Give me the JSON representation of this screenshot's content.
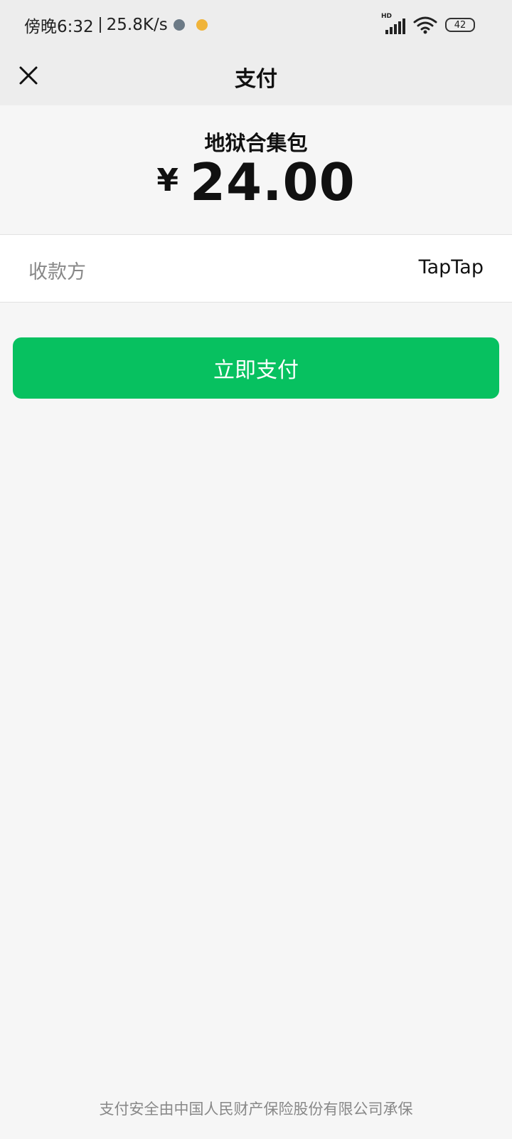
{
  "status_bar": {
    "time": "傍晚6:32",
    "speed": "25.8K/s",
    "battery": "42",
    "network_label": "HD",
    "icons": [
      "message-icon",
      "emoji-icon",
      "signal-icon",
      "wifi-icon",
      "battery-icon"
    ]
  },
  "header": {
    "title": "支付",
    "close_icon": "close-icon"
  },
  "order": {
    "product_name": "地狱合集包",
    "currency": "¥",
    "amount": "24.00"
  },
  "payee": {
    "label": "收款方",
    "value": "TapTap"
  },
  "actions": {
    "pay_label": "立即支付"
  },
  "footer": {
    "insurance_note": "支付安全由中国人民财产保险股份有限公司承保"
  },
  "colors": {
    "primary_green": "#07c160",
    "nav_background": "#ededed",
    "page_background": "#f6f6f6"
  }
}
